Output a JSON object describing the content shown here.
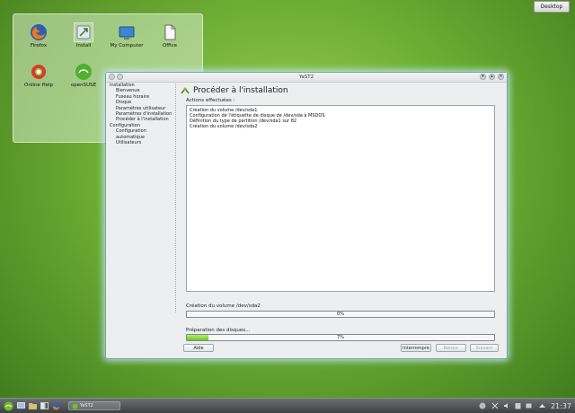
{
  "desktop": {
    "desktop_button": "Desktop",
    "icons": [
      {
        "label": "Firefox"
      },
      {
        "label": "Install"
      },
      {
        "label": "My Computer"
      },
      {
        "label": "Office"
      },
      {
        "label": "Online Help"
      },
      {
        "label": "openSUSE"
      }
    ]
  },
  "window": {
    "title": "YaST2",
    "steps": [
      {
        "label": "Installation",
        "level": 0
      },
      {
        "label": "Bienvenue",
        "level": 1
      },
      {
        "label": "Fuseau horaire",
        "level": 1
      },
      {
        "label": "Disque",
        "level": 1
      },
      {
        "label": "Paramètres utilisateur",
        "level": 1
      },
      {
        "label": "Paramètres d'installation",
        "level": 1
      },
      {
        "label": "Procéder à l'installation",
        "level": 1
      },
      {
        "label": "Configuration",
        "level": 0
      },
      {
        "label": "Configuration automatique",
        "level": 1
      },
      {
        "label": "Utilisateurs",
        "level": 1
      }
    ],
    "heading": "Procéder à l'installation",
    "actions_label": "Actions effectuées :",
    "actions": [
      "Création du volume /dev/sda1",
      "Configuration de l'étiquette de disque de /dev/sda à MSDOS",
      "Définition du type de partition /dev/sda1 sur 82",
      "Création du volume /dev/sda2"
    ],
    "progress1": {
      "label": "Création du volume /dev/sda2",
      "percent": 0,
      "text": "0%"
    },
    "progress2": {
      "label": "Préparation des disques...",
      "percent": 7,
      "text": "7%"
    },
    "buttons": {
      "help": "Aide",
      "abort": "Interrompre",
      "back": "Retour",
      "next": "Suivant"
    }
  },
  "taskbar": {
    "task_label": "YaST2",
    "clock": "21:37"
  },
  "colors": {
    "accent_green": "#6fc325",
    "window_glow": "#bef0ff"
  }
}
